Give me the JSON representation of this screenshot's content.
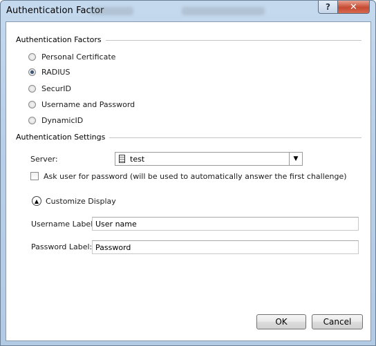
{
  "window": {
    "title": "Authentication Factor",
    "help_glyph": "?",
    "close_glyph": "✕"
  },
  "factors_group": {
    "header": "Authentication Factors",
    "options": [
      {
        "label": "Personal Certificate",
        "checked": false
      },
      {
        "label": "RADIUS",
        "checked": true
      },
      {
        "label": "SecurID",
        "checked": false
      },
      {
        "label": "Username and Password",
        "checked": false
      },
      {
        "label": "DynamicID",
        "checked": false
      }
    ]
  },
  "settings_group": {
    "header": "Authentication Settings",
    "server_label": "Server:",
    "server_value": "test",
    "ask_password_label": "Ask user for password (will be used to automatically answer the first challenge)",
    "ask_password_checked": false,
    "customize_label": "Customize Display",
    "username_label": "Username Label:",
    "username_value": "User name",
    "password_label": "Password Label:",
    "password_value": "Password"
  },
  "buttons": {
    "ok": "OK",
    "cancel": "Cancel"
  }
}
